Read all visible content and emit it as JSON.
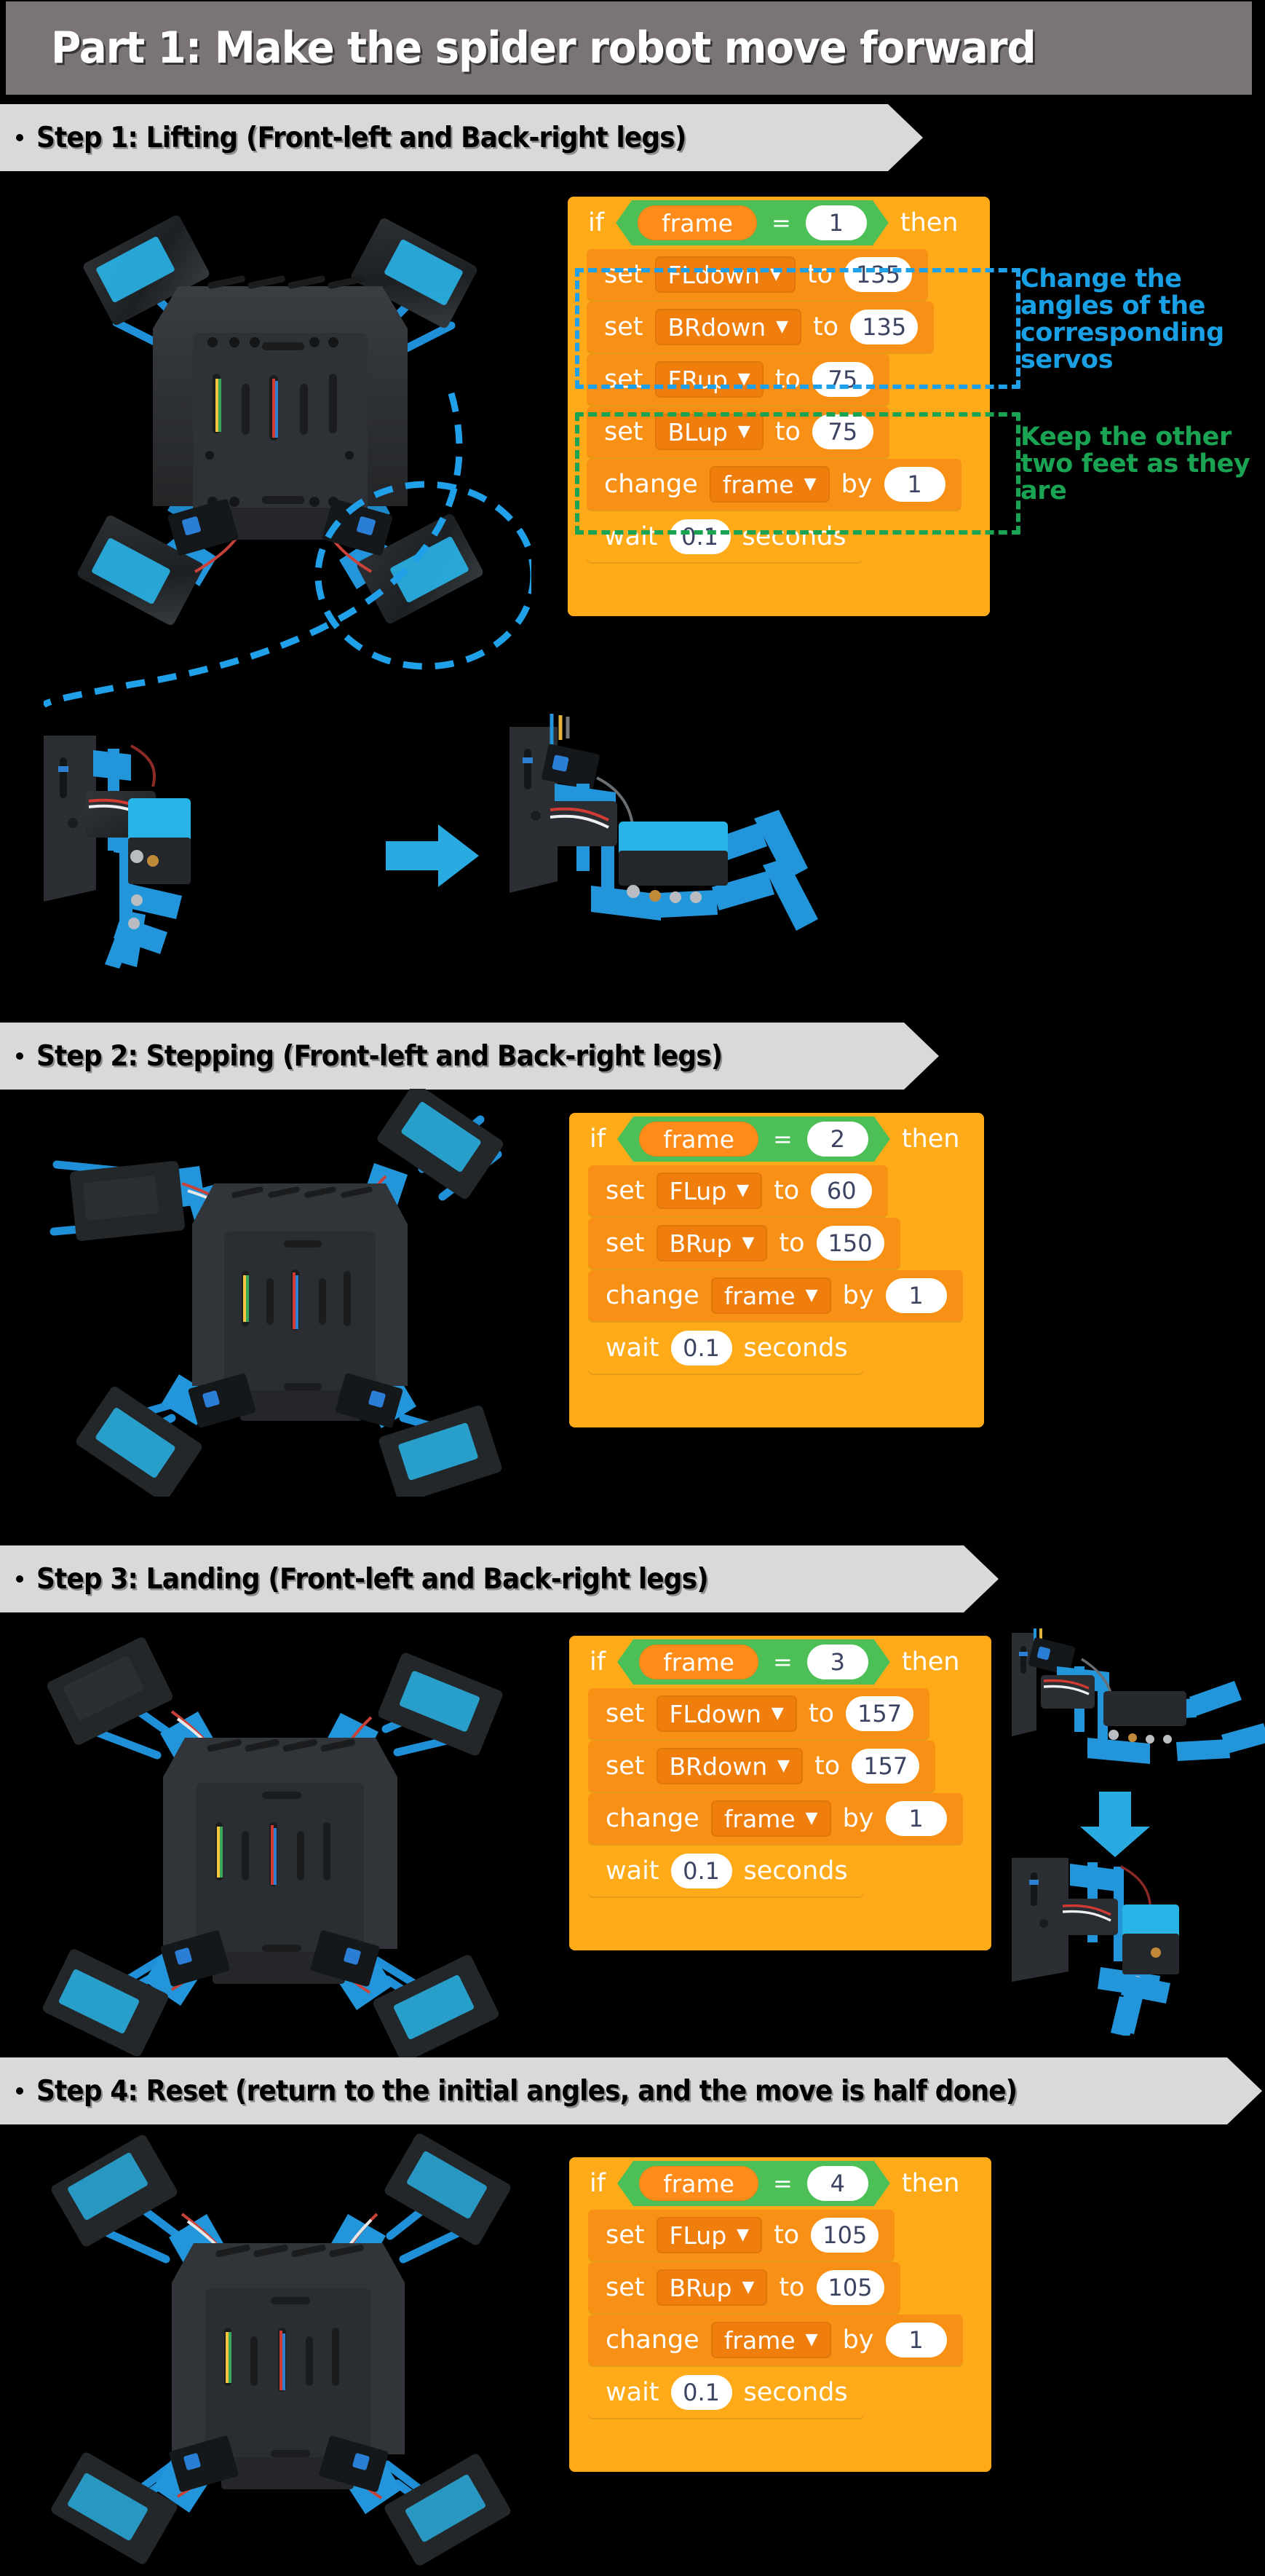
{
  "title": "Part 1: Make the spider robot move forward",
  "theme": {
    "title_bar_bg": "#7a7474",
    "banner_bg": "#d9d9d9",
    "page_bg": "#000000",
    "block_control": "#FFAB19",
    "block_stack": "#F79015",
    "block_dropdown": "#F07E0C",
    "block_operator": "#4CBF56",
    "block_variable": "#FF8C1A",
    "accent_blue": "#199FE3",
    "accent_green": "#19A352",
    "arrow_blue": "#29ABE2"
  },
  "steps": [
    {
      "banner": "Step 1: Lifting (Front-left and Back-right legs)",
      "script": {
        "if_label": "if",
        "then_label": "then",
        "variable": "frame",
        "operator": "=",
        "value": "1",
        "rows": [
          {
            "kind": "set",
            "verb": "set",
            "target": "FLdown",
            "prep": "to",
            "value": "135"
          },
          {
            "kind": "set",
            "verb": "set",
            "target": "BRdown",
            "prep": "to",
            "value": "135"
          },
          {
            "kind": "set",
            "verb": "set",
            "target": "FRup",
            "prep": "to",
            "value": "75"
          },
          {
            "kind": "set",
            "verb": "set",
            "target": "BLup",
            "prep": "to",
            "value": "75"
          },
          {
            "kind": "change",
            "verb": "change",
            "target": "frame",
            "prep": "by",
            "value": "1"
          },
          {
            "kind": "wait",
            "verb": "wait",
            "value": "0.1",
            "suffix": "seconds"
          }
        ]
      },
      "annotations": [
        {
          "color": "blue",
          "text": "Change the angles of the corresponding servos"
        },
        {
          "color": "green",
          "text": "Keep the other two feet as they are"
        }
      ]
    },
    {
      "banner": "Step 2: Stepping (Front-left and Back-right legs)",
      "script": {
        "if_label": "if",
        "then_label": "then",
        "variable": "frame",
        "operator": "=",
        "value": "2",
        "rows": [
          {
            "kind": "set",
            "verb": "set",
            "target": "FLup",
            "prep": "to",
            "value": "60"
          },
          {
            "kind": "set",
            "verb": "set",
            "target": "BRup",
            "prep": "to",
            "value": "150"
          },
          {
            "kind": "change",
            "verb": "change",
            "target": "frame",
            "prep": "by",
            "value": "1"
          },
          {
            "kind": "wait",
            "verb": "wait",
            "value": "0.1",
            "suffix": "seconds"
          }
        ]
      },
      "annotations": []
    },
    {
      "banner": "Step 3: Landing (Front-left and Back-right legs)",
      "script": {
        "if_label": "if",
        "then_label": "then",
        "variable": "frame",
        "operator": "=",
        "value": "3",
        "rows": [
          {
            "kind": "set",
            "verb": "set",
            "target": "FLdown",
            "prep": "to",
            "value": "157"
          },
          {
            "kind": "set",
            "verb": "set",
            "target": "BRdown",
            "prep": "to",
            "value": "157"
          },
          {
            "kind": "change",
            "verb": "change",
            "target": "frame",
            "prep": "by",
            "value": "1"
          },
          {
            "kind": "wait",
            "verb": "wait",
            "value": "0.1",
            "suffix": "seconds"
          }
        ]
      },
      "annotations": []
    },
    {
      "banner": "Step 4: Reset (return to the initial angles, and the move is half done)",
      "script": {
        "if_label": "if",
        "then_label": "then",
        "variable": "frame",
        "operator": "=",
        "value": "4",
        "rows": [
          {
            "kind": "set",
            "verb": "set",
            "target": "FLup",
            "prep": "to",
            "value": "105"
          },
          {
            "kind": "set",
            "verb": "set",
            "target": "BRup",
            "prep": "to",
            "value": "105"
          },
          {
            "kind": "change",
            "verb": "change",
            "target": "frame",
            "prep": "by",
            "value": "1"
          },
          {
            "kind": "wait",
            "verb": "wait",
            "value": "0.1",
            "suffix": "seconds"
          }
        ]
      },
      "annotations": []
    }
  ],
  "photos": {
    "s1_top": "spider-robot-top-view-lifting",
    "s1_detail_before": "leg-closeup-before",
    "s1_detail_after": "leg-closeup-after",
    "s2_top": "spider-robot-top-view-stepping",
    "s3_top": "spider-robot-top-view-landing",
    "s3_detail_before": "leg-closeup-lifted",
    "s3_detail_after": "leg-closeup-landed",
    "s4_top": "spider-robot-top-view-reset"
  }
}
